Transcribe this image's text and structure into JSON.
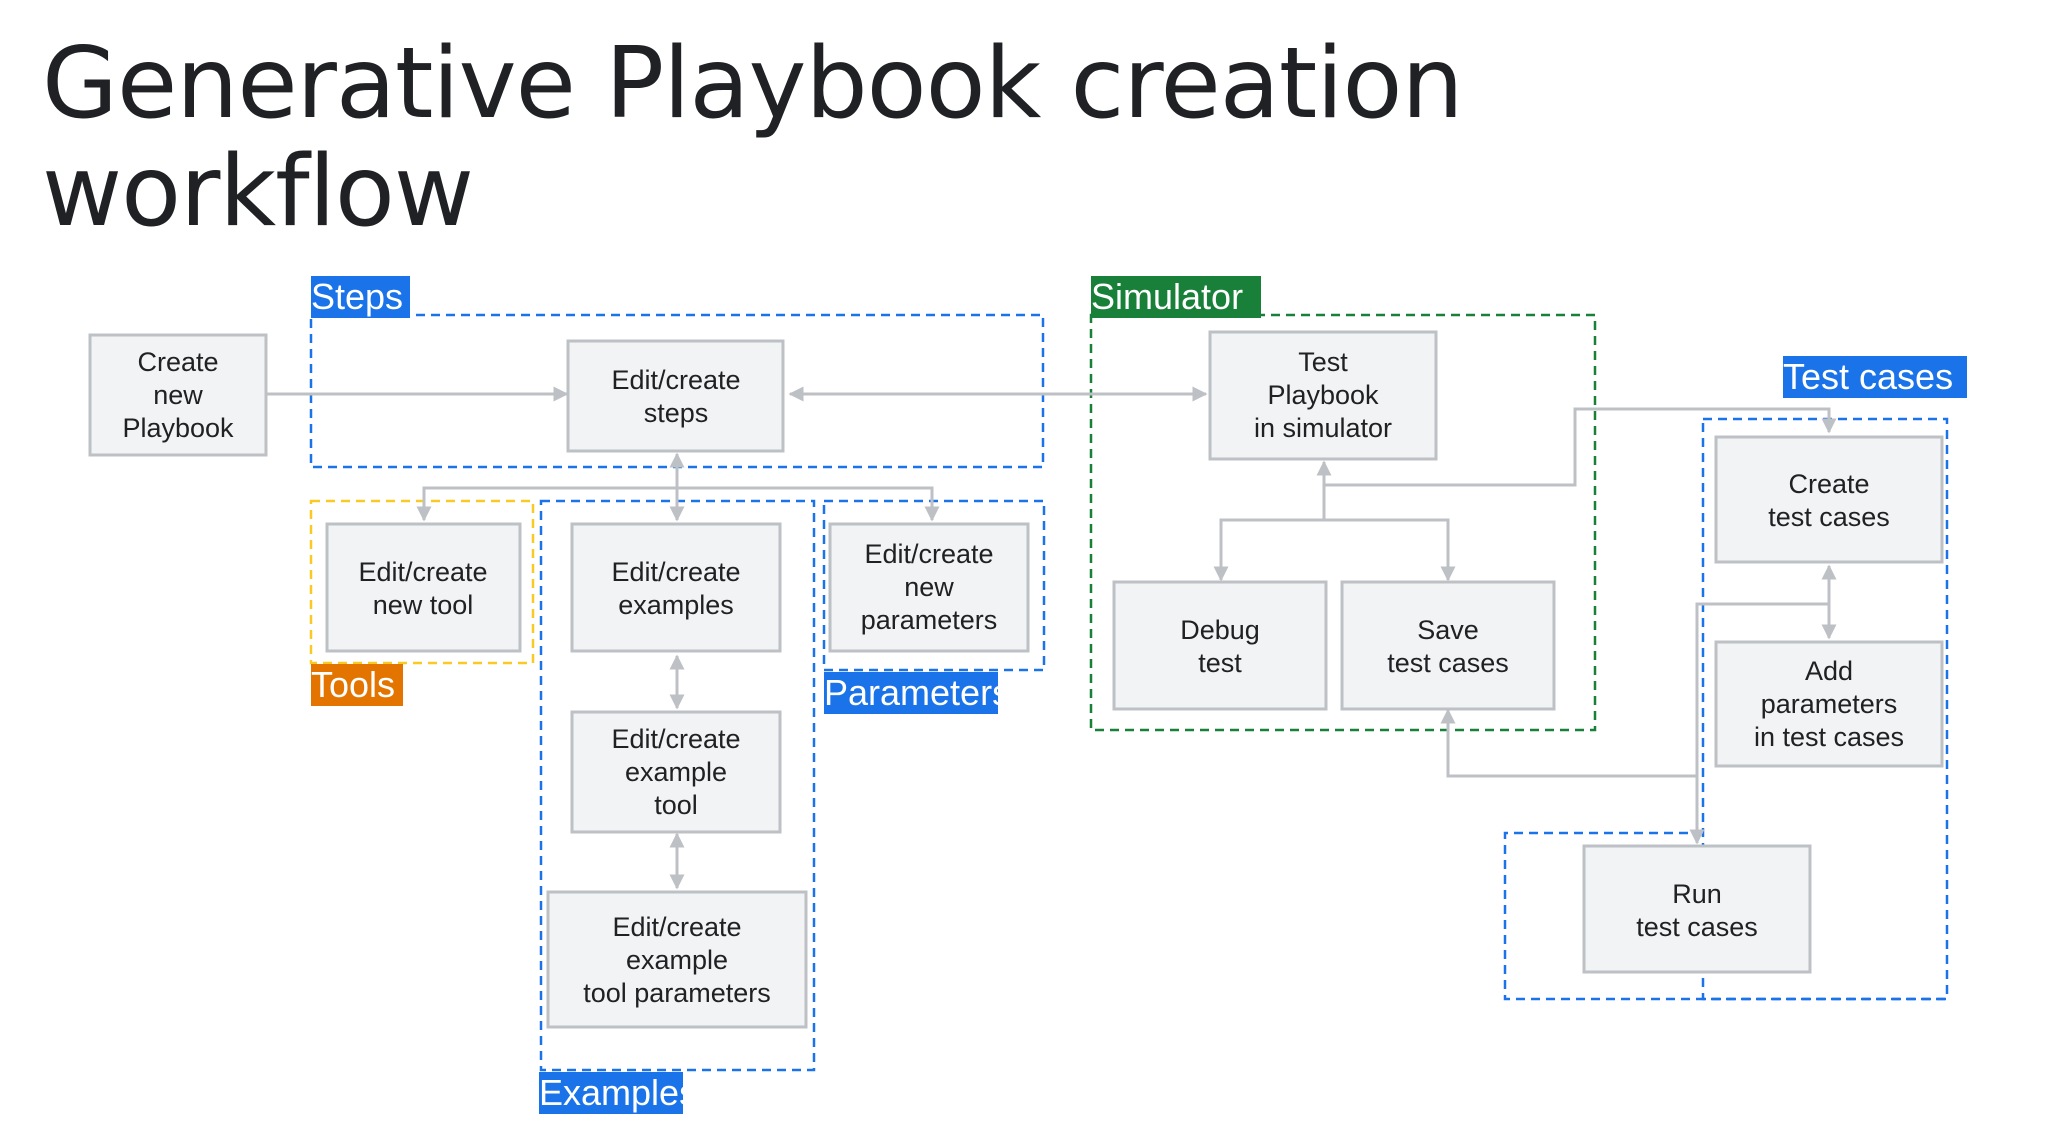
{
  "title": "Generative Playbook creation workflow",
  "colors": {
    "blue": "#1a73e8",
    "green": "#188038",
    "yellow": "#f9ca24",
    "orange": "#e37400",
    "node_fill": "#f1f3f4",
    "node_border": "#bdc1c6",
    "connector": "#bdc1c6"
  },
  "groups": {
    "steps": "Steps",
    "tools": "Tools",
    "examples": "Examples",
    "parameters": "Parameters",
    "simulator": "Simulator",
    "test_cases": "Test cases"
  },
  "nodes": {
    "create_playbook": [
      "Create",
      "new",
      "Playbook"
    ],
    "edit_steps": [
      "Edit/create",
      "steps"
    ],
    "edit_tool": [
      "Edit/create",
      "new tool"
    ],
    "edit_examples": [
      "Edit/create",
      "examples"
    ],
    "edit_example_tool": [
      "Edit/create",
      "example",
      "tool"
    ],
    "edit_example_tool_params": [
      "Edit/create",
      "example",
      "tool parameters"
    ],
    "edit_parameters": [
      "Edit/create",
      "new",
      "parameters"
    ],
    "test_playbook": [
      "Test",
      "Playbook",
      "in simulator"
    ],
    "debug_test": [
      "Debug",
      "test"
    ],
    "save_test_cases": [
      "Save",
      "test cases"
    ],
    "create_test_cases": [
      "Create",
      "test cases"
    ],
    "add_parameters": [
      "Add",
      "parameters",
      "in test cases"
    ],
    "run_test_cases": [
      "Run",
      "test cases"
    ]
  }
}
